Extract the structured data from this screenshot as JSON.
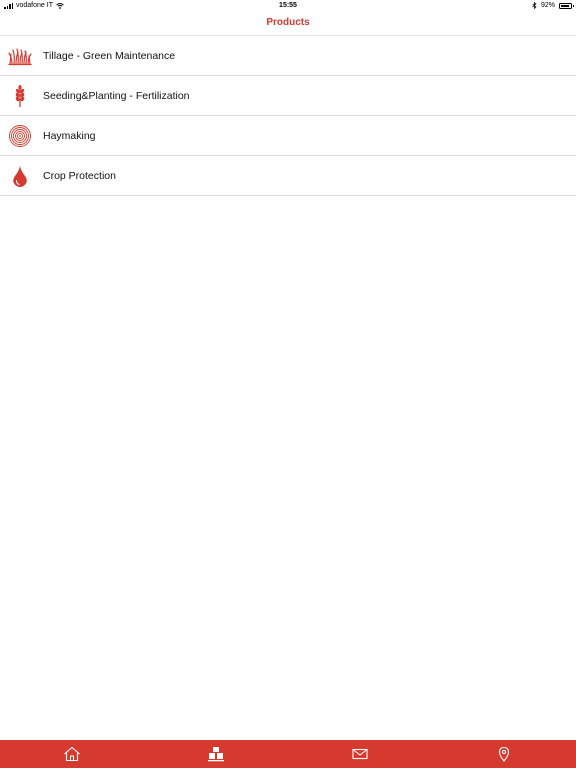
{
  "status_bar": {
    "carrier": "vodafone IT",
    "time": "15:55",
    "battery": "92%",
    "battery_level": 0.92,
    "icons": [
      "signal-icon",
      "wifi-icon",
      "bluetooth-icon",
      "battery-icon"
    ]
  },
  "nav": {
    "title": "Products"
  },
  "products": {
    "items": [
      {
        "label": "Tillage - Green Maintenance",
        "icon": "grass-icon"
      },
      {
        "label": "Seeding&Planting - Fertilization",
        "icon": "wheat-icon"
      },
      {
        "label": "Haymaking",
        "icon": "hay-bale-icon"
      },
      {
        "label": "Crop Protection",
        "icon": "drop-icon"
      }
    ]
  },
  "tab_bar": {
    "tabs": [
      {
        "icon": "home-icon",
        "selected": false
      },
      {
        "icon": "products-icon",
        "selected": true
      },
      {
        "icon": "mail-icon",
        "selected": false
      },
      {
        "icon": "location-pin-icon",
        "selected": false
      }
    ]
  },
  "colors": {
    "accent": "#d63a2f",
    "text": "#111111",
    "divider": "#dcdcdc",
    "background": "#ffffff"
  }
}
